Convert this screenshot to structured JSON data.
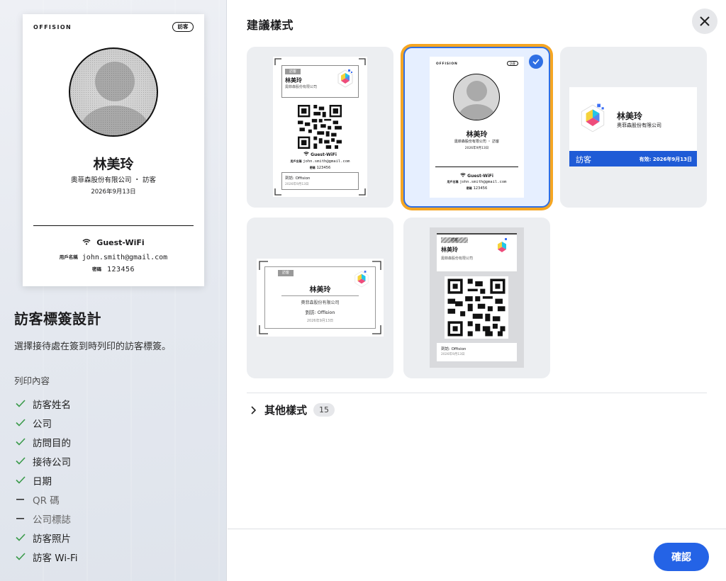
{
  "preview": {
    "brand": "OFFISION",
    "tag": "訪客",
    "name": "林美玲",
    "company_line": "奧菲森股份有限公司 ・ 訪客",
    "date": "2026年9月13日",
    "wifi_title": "Guest-WiFi",
    "user_key": "用戶名稱",
    "user_value": "john.smith@gmail.com",
    "pass_key": "密碼",
    "pass_value": "123456"
  },
  "left": {
    "title": "訪客標簽設計",
    "description": "選擇接待處在簽到時列印的訪客標簽。",
    "print_label": "列印內容",
    "items": [
      {
        "label": "訪客姓名",
        "checked": true
      },
      {
        "label": "公司",
        "checked": true
      },
      {
        "label": "訪問目的",
        "checked": true
      },
      {
        "label": "接待公司",
        "checked": true
      },
      {
        "label": "日期",
        "checked": true
      },
      {
        "label": "QR 碼",
        "checked": false
      },
      {
        "label": "公司標誌",
        "checked": false
      },
      {
        "label": "訪客照片",
        "checked": true
      },
      {
        "label": "訪客 Wi-Fi",
        "checked": true
      }
    ]
  },
  "right": {
    "title": "建議樣式",
    "more_label": "其他樣式",
    "more_count": "15",
    "confirm_label": "確認"
  },
  "styles": {
    "s1": {
      "tag": "訪客",
      "name": "林美玲",
      "company": "奧菲森股份有限公司",
      "wifi": "Guest-WiFi",
      "user_key": "用戶名稱",
      "user": "john.smith@gmail.com",
      "pass_key": "密碼",
      "pass": "123456",
      "visit": "到訪: Offision",
      "date": "2026年9月13日"
    },
    "s2": {
      "brand": "OFFISION",
      "tag": "訪客",
      "name": "林美玲",
      "company": "奧菲森股份有限公司 ・ 訪客",
      "date": "2026年9月13日",
      "wifi": "Guest-WiFi",
      "user_key": "用戶名稱",
      "user": "john.smith@gmail.com",
      "pass_key": "密碼",
      "pass": "123456"
    },
    "s3": {
      "name": "林美玲",
      "company": "奧菲森股份有限公司",
      "tag": "訪客",
      "valid": "有效: 2026年9月13日"
    },
    "s4": {
      "tag": "訪客",
      "name": "林美玲",
      "company": "奧菲森股份有限公司",
      "visit": "到訪: Offision",
      "date": "2026年9月13日"
    },
    "s5": {
      "tag": "訪客",
      "name": "林美玲",
      "company": "奧菲森股份有限公司",
      "visit": "到訪: Offision",
      "date": "2026年9月13日"
    }
  },
  "colors": {
    "accent": "#2463e6",
    "selection_ring": "#f5a623",
    "band": "#1f5bd6"
  }
}
